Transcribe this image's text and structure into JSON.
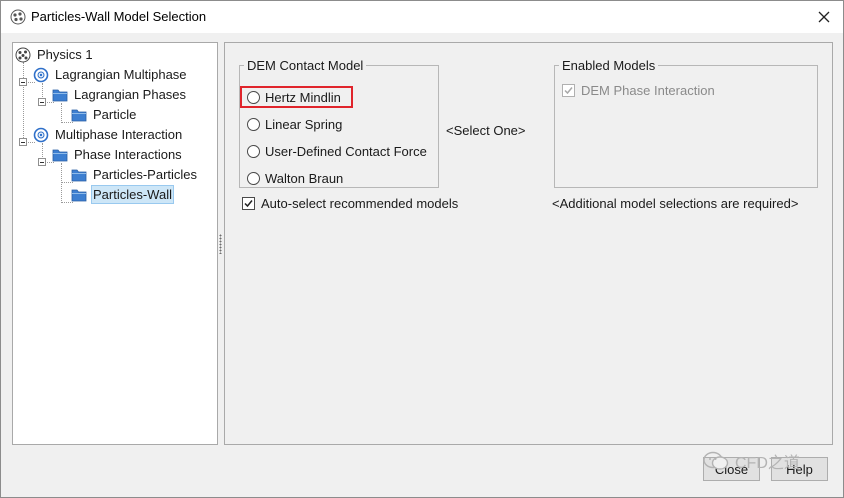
{
  "window": {
    "title": "Particles-Wall Model Selection",
    "icon": "particles-app-icon"
  },
  "tree": {
    "items": [
      {
        "label": "Physics 1",
        "icon": "physics-globe-icon",
        "selected": false
      },
      {
        "label": "Lagrangian Multiphase",
        "icon": "model-ring-icon",
        "selected": false
      },
      {
        "label": "Lagrangian Phases",
        "icon": "folder-icon",
        "selected": false
      },
      {
        "label": "Particle",
        "icon": "folder-icon",
        "selected": false
      },
      {
        "label": "Multiphase Interaction",
        "icon": "model-ring-icon",
        "selected": false
      },
      {
        "label": "Phase Interactions",
        "icon": "folder-icon",
        "selected": false
      },
      {
        "label": "Particles-Particles",
        "icon": "folder-icon",
        "selected": false
      },
      {
        "label": "Particles-Wall",
        "icon": "folder-icon",
        "selected": true
      }
    ]
  },
  "dem_group": {
    "legend": "DEM Contact Model",
    "options": [
      {
        "label": "Hertz Mindlin",
        "highlighted": true
      },
      {
        "label": "Linear Spring",
        "highlighted": false
      },
      {
        "label": "User-Defined Contact Force",
        "highlighted": false
      },
      {
        "label": "Walton Braun",
        "highlighted": false
      }
    ],
    "hint": "<Select One>"
  },
  "enabled_group": {
    "legend": "Enabled Models",
    "items": [
      {
        "label": "DEM Phase Interaction",
        "checked": true,
        "disabled": true
      }
    ]
  },
  "auto_select": {
    "label": "Auto-select recommended models",
    "checked": true
  },
  "additional_note": "<Additional model selections are required>",
  "buttons": {
    "close": "Close",
    "help": "Help"
  },
  "watermark": "CFD之道",
  "colors": {
    "highlight": "#e0242b",
    "selection": "#cde6f7",
    "folder": "#3d7fd1"
  }
}
